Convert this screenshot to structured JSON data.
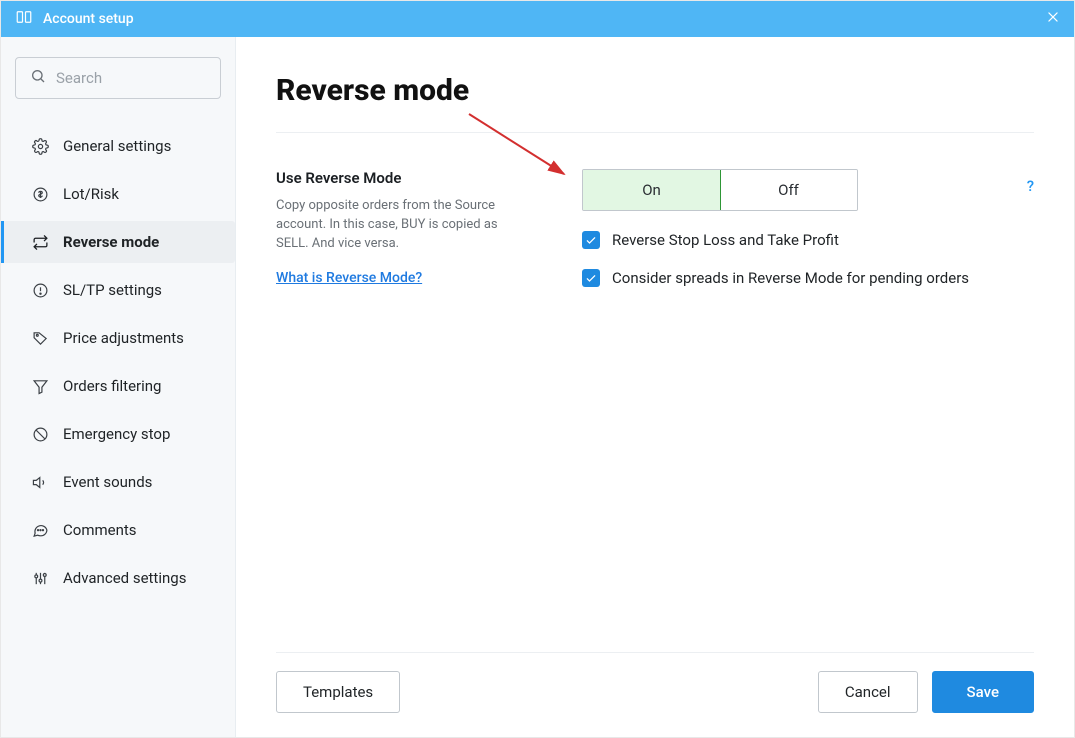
{
  "titlebar": {
    "title": "Account setup"
  },
  "search": {
    "placeholder": "Search"
  },
  "sidebar": {
    "items": [
      {
        "label": "General settings"
      },
      {
        "label": "Lot/Risk"
      },
      {
        "label": "Reverse mode"
      },
      {
        "label": "SL/TP settings"
      },
      {
        "label": "Price adjustments"
      },
      {
        "label": "Orders filtering"
      },
      {
        "label": "Emergency stop"
      },
      {
        "label": "Event sounds"
      },
      {
        "label": "Comments"
      },
      {
        "label": "Advanced settings"
      }
    ]
  },
  "page": {
    "title": "Reverse mode",
    "field_label": "Use Reverse Mode",
    "field_help": "Copy opposite orders from the Source account. In this case, BUY is copied as SELL. And vice versa.",
    "link": "What is Reverse Mode?",
    "toggle": {
      "on": "On",
      "off": "Off",
      "value": "on"
    },
    "help_icon": "?",
    "checks": [
      {
        "label": "Reverse Stop Loss and Take Profit",
        "checked": true
      },
      {
        "label": "Consider spreads in Reverse Mode for pending orders",
        "checked": true
      }
    ]
  },
  "footer": {
    "templates": "Templates",
    "cancel": "Cancel",
    "save": "Save"
  }
}
